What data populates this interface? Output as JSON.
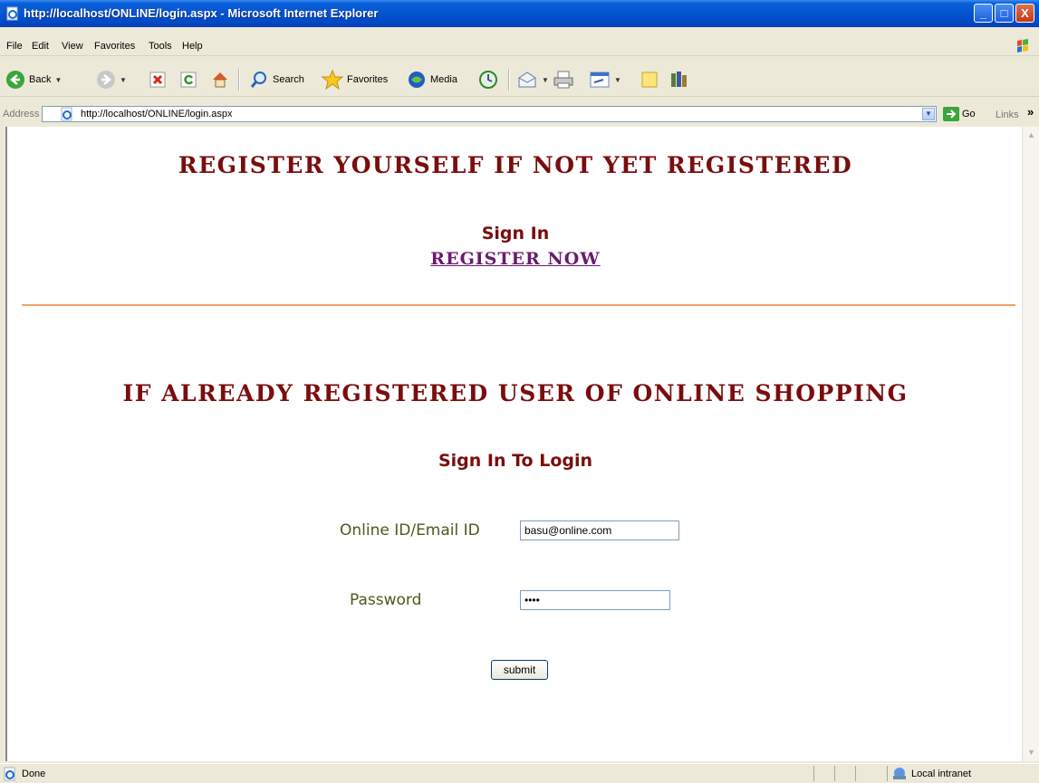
{
  "window": {
    "title": "http://localhost/ONLINE/login.aspx - Microsoft Internet Explorer",
    "min_glyph": "_",
    "max_glyph": "□",
    "close_glyph": "X"
  },
  "menu": [
    "File",
    "Edit",
    "View",
    "Favorites",
    "Tools",
    "Help"
  ],
  "toolbar": {
    "back_label": "Back",
    "search_label": "Search",
    "favorites_label": "Favorites",
    "media_label": "Media"
  },
  "address": {
    "label": "Address",
    "url": "http://localhost/ONLINE/login.aspx",
    "go_label": "Go",
    "links_label": "Links"
  },
  "page": {
    "heading_register": "REGISTER YOURSELF IF NOT YET REGISTERED",
    "signin_label": "Sign In",
    "register_now_link": "REGISTER NOW",
    "heading_existing": "IF ALREADY REGISTERED USER OF ONLINE SHOPPING",
    "signin_to_login": "Sign In To Login",
    "email_label": "Online ID/Email ID",
    "email_value": "basu@online.com",
    "password_label": "Password",
    "password_value": "••••",
    "submit_label": "submit"
  },
  "status": {
    "text": "Done",
    "zone": "Local intranet"
  },
  "colors": {
    "heading": "#7a0d0d",
    "link": "#6b1a6e",
    "label": "#4a5a1e",
    "divider": "#f6a264"
  }
}
